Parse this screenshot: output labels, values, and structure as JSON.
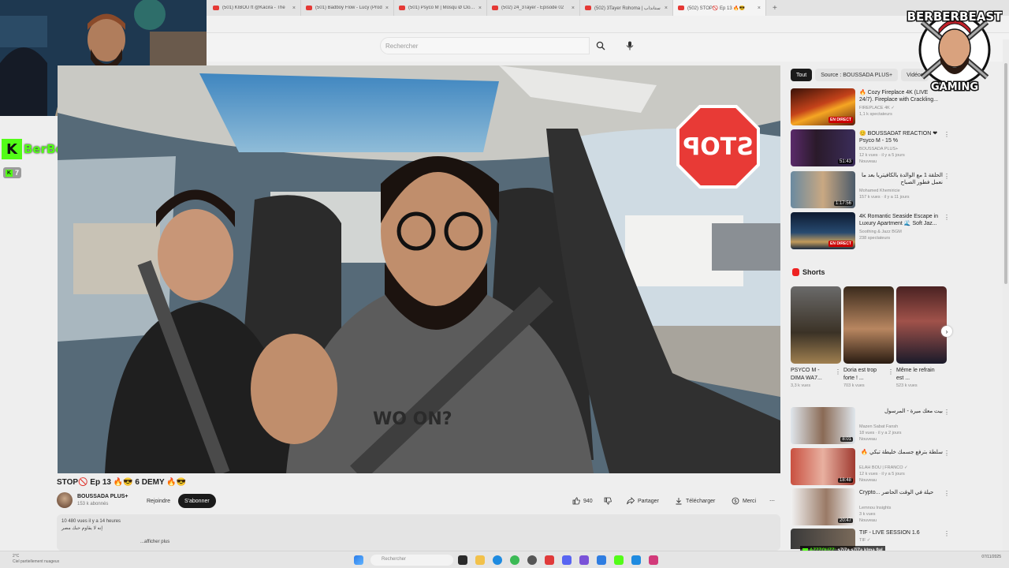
{
  "browser": {
    "tabs": [
      {
        "title": "(501) KIBOU ft @Kacira - The"
      },
      {
        "title": "(501) Badboy Flow - Lucy (Prod"
      },
      {
        "title": "(501) Psyco M | Mosqu Ø Clope"
      },
      {
        "title": "(502) 24_3Tayer - Episode 02"
      },
      {
        "title": "(502) 3Tayer Rohoma | ستاندآب"
      },
      {
        "title": "(502) STOP🚫 Ep 13 🔥😎"
      }
    ],
    "new_tab": "+",
    "close": "×"
  },
  "search": {
    "placeholder": "Rechercher"
  },
  "stream_overlay": {
    "streamer": "BerBerBeast",
    "viewers": "7",
    "brand_top": "BERBERBEAST",
    "brand_bottom": "GAMING",
    "chat": {
      "user": "AZZZOUZZ:",
      "message": "s7i7a s7i7a klma 9al"
    }
  },
  "video": {
    "stop_sign": "STOP",
    "title": "STOP🚫 Ep 13 🔥😎 6 DEMY 🔥😎",
    "channel": "BOUSSADA PLUS+",
    "subscribers": "153 k abonnés",
    "join": "Rejoindre",
    "subscribe": "S'abonner",
    "likes": "940",
    "share": "Partager",
    "download": "Télécharger",
    "thanks": "Merci",
    "more": "⋯",
    "views_time": "10 480 vues  il y a 14 heures",
    "desc_line1": "إنه لا يقاوم حبك مصر",
    "desc_line2": "...afficher plus"
  },
  "sidebar": {
    "chips": [
      "Tout",
      "Source : BOUSSADA PLUS+",
      "Vidéos"
    ],
    "recommended": [
      {
        "title": "🔥 Cozy Fireplace 4K (LIVE 24/7). Fireplace with Crackling...",
        "channel": "FIREPLACE 4K ✓",
        "meta": "1,1 k spectateurs",
        "badge": "EN DIRECT"
      },
      {
        "title": "😊 BOUSSADAT REACTION ❤ Psyco M - 15 %",
        "channel": "BOUSSADA PLUS+",
        "meta": "12 k vues · il y a 5 jours",
        "extra": "Nouveau",
        "badge": "51:43"
      },
      {
        "title": "الحلقة 1 مع الوالدة بالكافيتريا بعد ما نعمل فطور الصباح",
        "channel": "Mohamed Khemiricie",
        "meta": "157 k vues · il y a 11 jours",
        "badge": "1:17:56"
      },
      {
        "title": "4K Romantic Seaside Escape in Luxury Apartment 🌊 Soft Jaz...",
        "channel": "Soothing & Jazz BGM",
        "meta": "238 spectateurs",
        "badge": "EN DIRECT"
      }
    ],
    "shorts_heading": "Shorts",
    "shorts": [
      {
        "title": "PSYCO M - DIMA WA7...",
        "views": "3,3 k vues"
      },
      {
        "title": "Doria est trop forte ! ...",
        "views": "703 k vues"
      },
      {
        "title": "Même le refrain est ...",
        "views": "523 k vues"
      }
    ],
    "more_videos": [
      {
        "title": "بيت معك ميرة - المرسول",
        "channel": "Mazen Sabat Fansh",
        "meta": "18 vues · il y a 2 jours",
        "extra": "Nouveau",
        "badge": "8:01"
      },
      {
        "title": "سلطة بترفع جسمك خليطة تبكي 🔥",
        "channel": "ELAH BOU | FRANCO ✓",
        "meta": "12 k vues · il y a 5 jours",
        "extra": "Nouveau",
        "badge": "18:48"
      },
      {
        "title": "Crypto... حيلة في الوقت الحاضر",
        "channel": "Lemnou Insights",
        "meta": "3 k vues",
        "extra": "Nouveau",
        "badge": "20:47"
      },
      {
        "title": "TIF - LIVE SESSION 1.6",
        "channel": "TIF ✓",
        "meta": "",
        "badge": ""
      }
    ]
  },
  "taskbar": {
    "weather_temp": "2°C",
    "weather_desc": "Ciel partiellement nuageux",
    "search": "Rechercher",
    "date": "07/11/2025"
  }
}
